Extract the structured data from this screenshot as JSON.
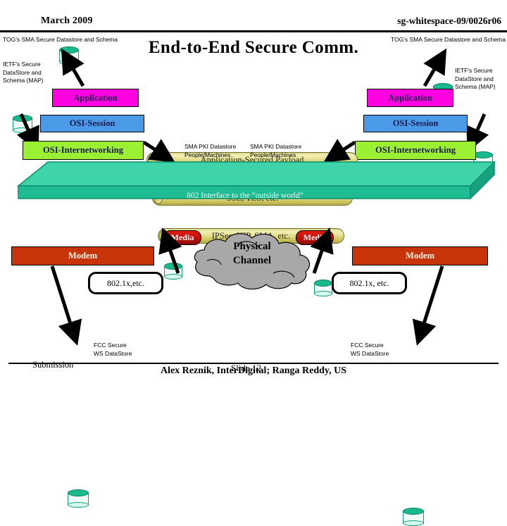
{
  "header": {
    "date": "March 2009",
    "doc_id": "sg-whitespace-09/0026r06"
  },
  "title": "End-to-End Secure Comm.",
  "left_side": {
    "tog_label": "TOG's SMA Secure Datastore and Schema",
    "ietf_label": "IETF's Secure DataStore and Schema (MAP)",
    "layers": [
      {
        "label": "Application"
      },
      {
        "label": "OSI-Session"
      },
      {
        "label": "OSI-Internetworking"
      }
    ]
  },
  "right_side": {
    "tog_label": "TOG's SMA Secure Datastore and Schema",
    "ietf_label": "IETF's Secure DataStore and Schema (MAP)",
    "layers": [
      {
        "label": "Application"
      },
      {
        "label": "OSI-Session"
      },
      {
        "label": "OSI-Internetworking"
      }
    ]
  },
  "payload_cylinders": [
    {
      "label": "Application-Secured Payload"
    },
    {
      "label": "SSL, TLS, etc."
    },
    {
      "label": "IPSec, HIP, SMA, etc."
    }
  ],
  "center_datastores": [
    {
      "line1": "SMA PKI Datastore",
      "line2": "People/Machines"
    },
    {
      "line1": "SMA PKI Datastore",
      "line2": "People/Machines"
    }
  ],
  "platform": {
    "label": "802 Interface to the “outside world”"
  },
  "physical": {
    "media_left": "Media",
    "media_right": "Media",
    "cloud_line1": "Physical",
    "cloud_line2": "Channel",
    "modem_left": "Modem",
    "modem_right": "Modem",
    "callout_left": "802.1x,etc.",
    "callout_right": "802.1x, etc."
  },
  "fcc_datastores": [
    {
      "line1": "FCC Secure",
      "line2": "WS DataStore"
    },
    {
      "line1": "FCC Secure",
      "line2": "WS DataStore"
    }
  ],
  "footer": {
    "submission": "Submission",
    "slide": "Slide 12",
    "authors": "Alex Reznik, InterDigital; Ranga Reddy, US"
  },
  "colors": {
    "application": "#ff00e0",
    "session": "#4a9ae8",
    "internetworking": "#9cf034",
    "platform": "#28c79b",
    "modem": "#c8340a",
    "media": "#c8120a",
    "cylinder": "#e6e192",
    "cloud": "#a8a8a8",
    "datastore": "#18b98d"
  }
}
